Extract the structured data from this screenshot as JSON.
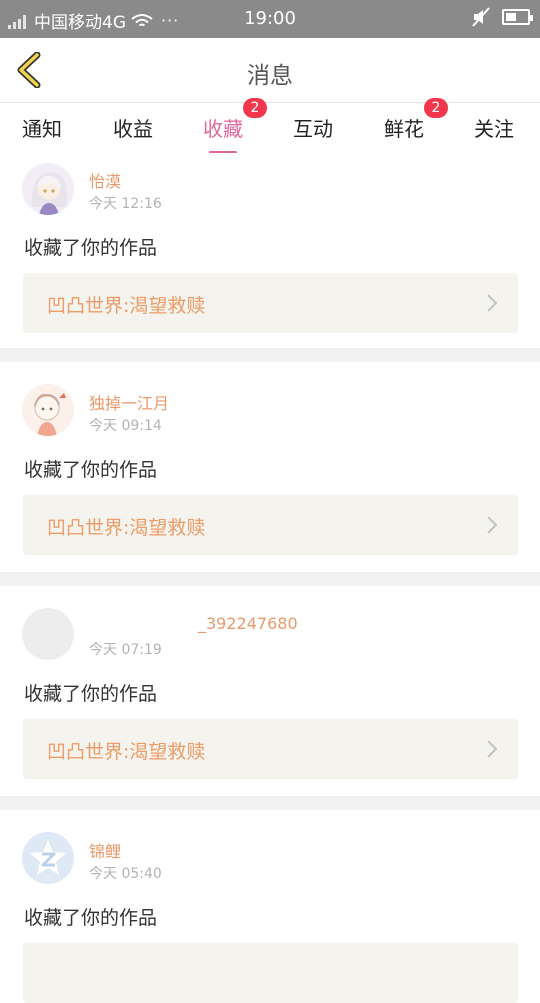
{
  "status_bar": {
    "carrier": "中国移动4G",
    "dots": "···",
    "time": "19:00"
  },
  "header": {
    "title": "消息"
  },
  "tabs": [
    {
      "label": "通知",
      "badge": ""
    },
    {
      "label": "收益",
      "badge": ""
    },
    {
      "label": "收藏",
      "badge": "2",
      "active": true
    },
    {
      "label": "互动",
      "badge": ""
    },
    {
      "label": "鲜花",
      "badge": "2"
    },
    {
      "label": "关注",
      "badge": ""
    }
  ],
  "items": [
    {
      "username": "怡漠",
      "time": "今天 12:16",
      "action": "收藏了你的作品",
      "work": "凹凸世界:渴望救赎"
    },
    {
      "username": "独掉一江月",
      "time": "今天 09:14",
      "action": "收藏了你的作品",
      "work": "凹凸世界:渴望救赎"
    },
    {
      "username": "_392247680",
      "time": "今天 07:19",
      "action": "收藏了你的作品",
      "work": "凹凸世界:渴望救赎"
    },
    {
      "username": "锦鲤",
      "time": "今天 05:40",
      "action": "收藏了你的作品",
      "work": ""
    }
  ],
  "colors": {
    "accent_pink": "#e0679b",
    "badge_red": "#f2374d",
    "username_orange": "#e89a6a",
    "work_orange": "#ec9c68",
    "status_bar": "#8a8a8a"
  }
}
